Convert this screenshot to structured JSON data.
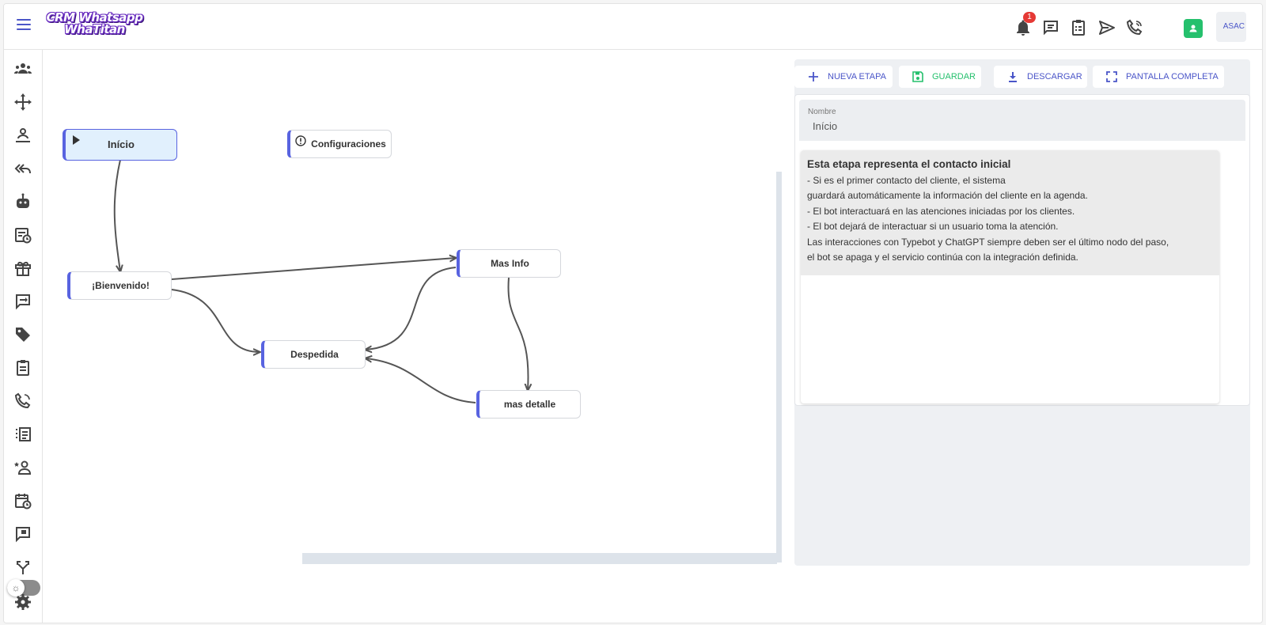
{
  "header": {
    "logo_line1": "CRM Whatsapp",
    "logo_line2": "WhaTitan",
    "notification_count": "1",
    "avatar_text": "ASAC"
  },
  "icons": {
    "menu": "hamburger-icon",
    "notifications": "bell-icon",
    "chat": "chat-icon",
    "tasks": "clipboard-icon",
    "send": "send-icon",
    "calls": "phone-icon",
    "contact": "contact-icon"
  },
  "sidebar": {
    "items": [
      {
        "icon": "groups-icon"
      },
      {
        "icon": "move-icon"
      },
      {
        "icon": "user-queue-icon"
      },
      {
        "icon": "reply-all-icon"
      },
      {
        "icon": "bot-icon"
      },
      {
        "icon": "scheduled-icon"
      },
      {
        "icon": "gift-icon"
      },
      {
        "icon": "transfer-icon"
      },
      {
        "icon": "tag-icon"
      },
      {
        "icon": "clipboard-icon"
      },
      {
        "icon": "phone-icon"
      },
      {
        "icon": "list-icon"
      },
      {
        "icon": "user-star-icon"
      },
      {
        "icon": "calendar-clock-icon"
      },
      {
        "icon": "feedback-icon"
      },
      {
        "icon": "fork-icon"
      },
      {
        "icon": "settings-icon"
      }
    ],
    "theme_toggle": "sun-icon"
  },
  "flow": {
    "nodes": [
      {
        "id": "inicio",
        "label": "Início"
      },
      {
        "id": "configuraciones",
        "label": "Configuraciones"
      },
      {
        "id": "bienvenido",
        "label": "¡Bienvenido!"
      },
      {
        "id": "mas_info",
        "label": "Mas Info"
      },
      {
        "id": "despedida",
        "label": "Despedida"
      },
      {
        "id": "mas_detalle",
        "label": "mas detalle"
      }
    ]
  },
  "toolbar": {
    "nueva_etapa": "Nueva Etapa",
    "guardar": "Guardar",
    "descargar": "Descargar",
    "pantalla_completa": "Pantalla Completa"
  },
  "colors": {
    "accent": "#4a55c8",
    "save": "#25c06d",
    "node_border": "#5863e0",
    "start_node_bg": "#e1f0fd"
  },
  "form": {
    "name_label": "Nombre",
    "name_value": "Início",
    "description_title": "Esta etapa representa el contacto inicial",
    "description_lines": [
      "- Si es el primer contacto del cliente, el sistema",
      "guardará automáticamente la información del cliente en la agenda.",
      "- El bot interactuará en las atenciones iniciadas por los clientes.",
      "- El bot dejará de interactuar si un usuario toma la atención.",
      "Las interacciones con Typebot y ChatGPT siempre deben ser el último nodo del paso,",
      "el bot se apaga y el servicio continúa con la integración definida."
    ]
  }
}
